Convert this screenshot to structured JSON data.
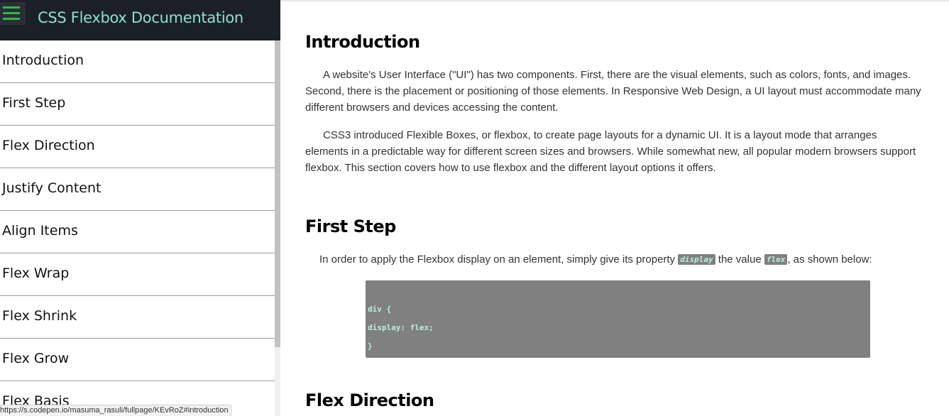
{
  "sidebar": {
    "title": "CSS Flexbox Documentation",
    "menu_icon": "hamburger-menu-icon",
    "items": [
      {
        "label": "Introduction"
      },
      {
        "label": "First Step"
      },
      {
        "label": "Flex Direction"
      },
      {
        "label": "Justify Content"
      },
      {
        "label": "Align Items"
      },
      {
        "label": "Flex Wrap"
      },
      {
        "label": "Flex Shrink"
      },
      {
        "label": "Flex Grow"
      },
      {
        "label": "Flex Basis"
      }
    ]
  },
  "status_bar": {
    "url": "https://s.codepen.io/masuma_rasuli/fullpage/KEvRoZ#introduction"
  },
  "main": {
    "introduction": {
      "title": "Introduction",
      "p1": "A website's User Interface (\"UI\") has two components. First, there are the visual elements, such as colors, fonts, and images. Second, there is the placement or positioning of those elements. In Responsive Web Design, a UI layout must accommodate many different browsers and devices accessing the content.",
      "p2": "CSS3 introduced Flexible Boxes, or flexbox, to create page layouts for a dynamic UI. It is a layout mode that arranges elements in a predictable way for different screen sizes and browsers. While somewhat new, all popular modern browsers support flexbox. This section covers how to use flexbox and the different layout options it offers."
    },
    "first_step": {
      "title": "First Step",
      "text_before": "In order to apply the Flexbox display on an element, simply give its property ",
      "code1": "display",
      "text_middle": " the value ",
      "code2": "flex",
      "text_after": ", as shown below:",
      "code_lines": [
        "div {",
        "display: flex;",
        "}"
      ]
    },
    "flex_direction": {
      "title": "Flex Direction"
    }
  },
  "colors": {
    "header_bg": "#1b2027",
    "title_accent": "#8ee0c9",
    "menu_icon": "#2db84a",
    "code_bg": "#808080",
    "code_text": "#b8f0da"
  }
}
